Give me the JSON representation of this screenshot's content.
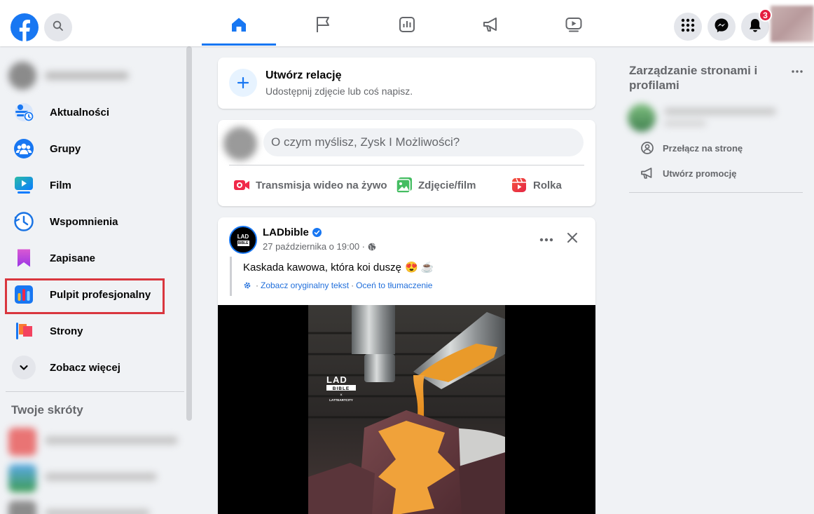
{
  "header": {
    "notifications_count": "3",
    "nav_tabs": [
      {
        "name": "home",
        "active": true
      },
      {
        "name": "pages",
        "active": false
      },
      {
        "name": "dashboard",
        "active": false
      },
      {
        "name": "ads",
        "active": false
      },
      {
        "name": "video",
        "active": false
      }
    ]
  },
  "sidebar": {
    "items": [
      {
        "label": "Aktualności",
        "icon": "news-feed-icon"
      },
      {
        "label": "Grupy",
        "icon": "groups-icon"
      },
      {
        "label": "Film",
        "icon": "watch-icon"
      },
      {
        "label": "Wspomnienia",
        "icon": "memories-icon"
      },
      {
        "label": "Zapisane",
        "icon": "saved-icon"
      },
      {
        "label": "Pulpit profesjonalny",
        "icon": "professional-dashboard-icon"
      },
      {
        "label": "Strony",
        "icon": "pages-icon"
      },
      {
        "label": "Zobacz więcej",
        "icon": "chevron-down-icon"
      }
    ],
    "shortcuts_title": "Twoje skróty"
  },
  "story": {
    "title": "Utwórz relację",
    "subtitle": "Udostępnij zdjęcie lub coś napisz."
  },
  "composer": {
    "placeholder": "O czym myślisz, Zysk I Możliwości?",
    "actions": [
      {
        "label": "Transmisja wideo na żywo",
        "icon": "live-video-icon",
        "color": "#f02849"
      },
      {
        "label": "Zdjęcie/film",
        "icon": "photo-video-icon",
        "color": "#45bd62"
      },
      {
        "label": "Rolka",
        "icon": "reel-icon",
        "color": "#e42645"
      }
    ]
  },
  "post": {
    "author": "LADbible",
    "timestamp": "27 października o 19:00 ·",
    "text": "Kaskada kawowa, która koi duszę",
    "emoji": "😍 ☕",
    "see_original": "Zobacz oryginalny tekst",
    "separator": "·",
    "rate_translation": "Oceń to tłumaczenie",
    "avatar_text_1": "LAD",
    "avatar_text_2": "BIBLE",
    "video_logo_1": "LAD",
    "video_logo_2": "BIBLE",
    "video_logo_x": "×",
    "video_logo_partner": "LATTEARTCITY"
  },
  "right": {
    "title": "Zarządzanie stronami i profilami",
    "links": [
      {
        "label": "Przełącz na stronę",
        "icon": "switch-profile-icon"
      },
      {
        "label": "Utwórz promocję",
        "icon": "megaphone-icon"
      }
    ]
  },
  "colors": {
    "brand": "#1877f2",
    "highlight_box": "#d9363e",
    "badge": "#e41e3f",
    "background": "#f0f2f5"
  }
}
